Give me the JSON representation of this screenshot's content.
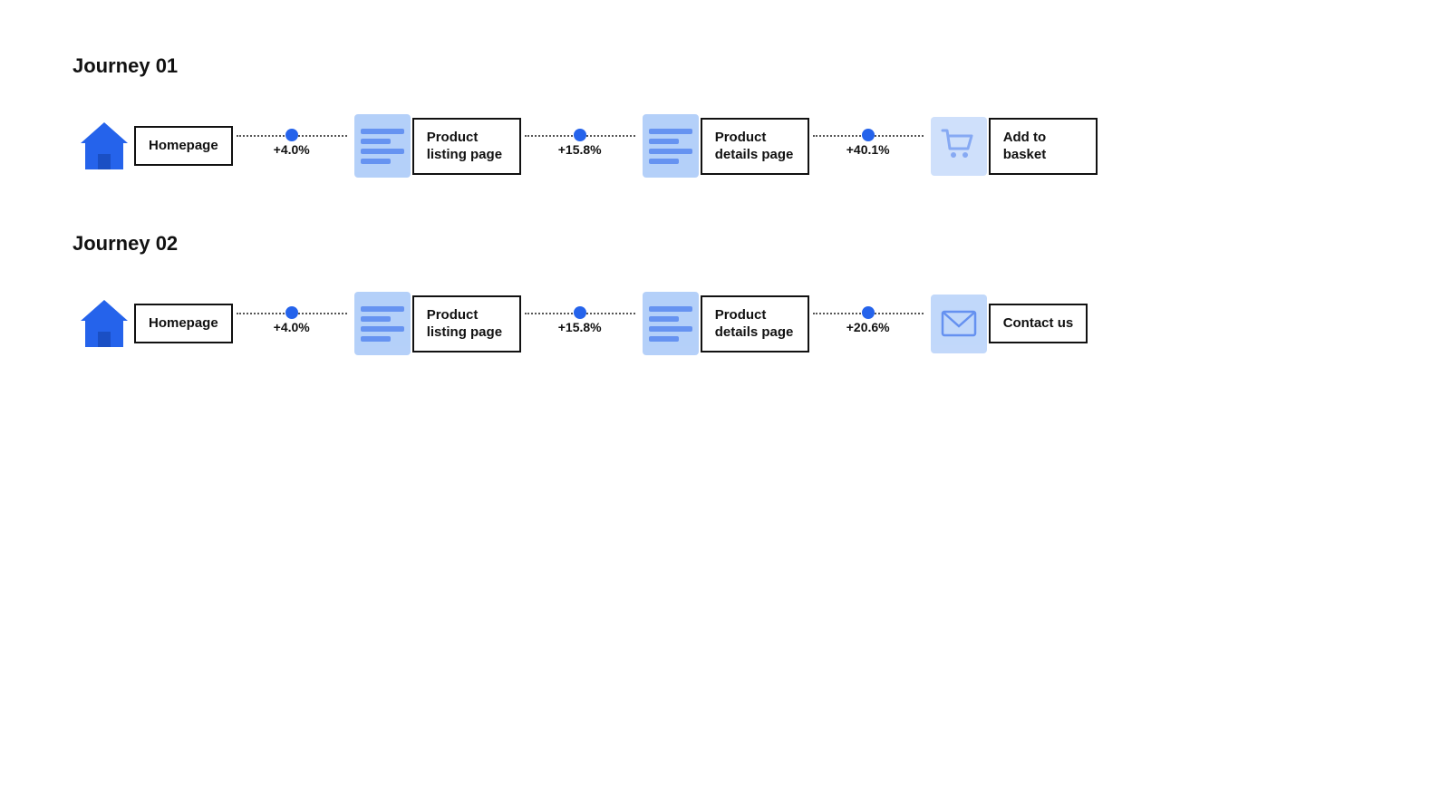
{
  "journeys": [
    {
      "id": "journey-01",
      "title": "Journey 01",
      "steps": [
        {
          "type": "home",
          "label": "Homepage"
        },
        {
          "type": "page",
          "label": "Product listing page",
          "lighter": false
        },
        {
          "type": "page",
          "label": "Product details page",
          "lighter": false
        },
        {
          "type": "cart",
          "label": "Add to basket"
        }
      ],
      "connectors": [
        {
          "pct": "+4.0%"
        },
        {
          "pct": "+15.8%"
        },
        {
          "pct": "+40.1%"
        }
      ]
    },
    {
      "id": "journey-02",
      "title": "Journey 02",
      "steps": [
        {
          "type": "home",
          "label": "Homepage"
        },
        {
          "type": "page",
          "label": "Product listing page",
          "lighter": false
        },
        {
          "type": "page",
          "label": "Product details page",
          "lighter": false
        },
        {
          "type": "envelope",
          "label": "Contact us"
        }
      ],
      "connectors": [
        {
          "pct": "+4.0%"
        },
        {
          "pct": "+15.8%"
        },
        {
          "pct": "+20.6%"
        }
      ]
    }
  ]
}
